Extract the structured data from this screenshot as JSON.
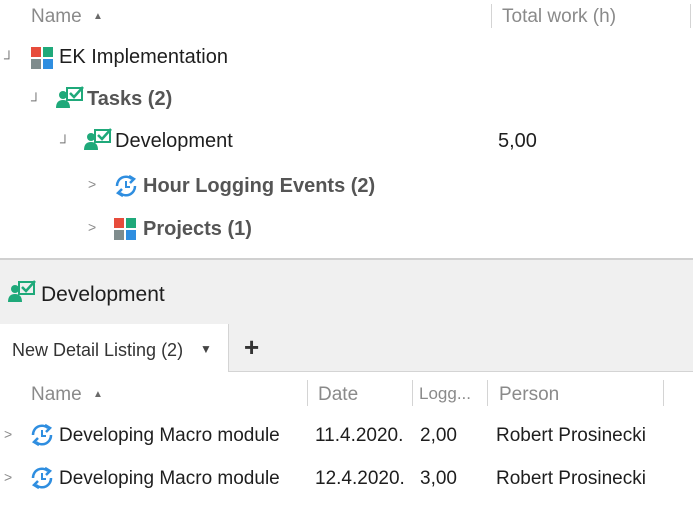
{
  "top_grid": {
    "columns": [
      {
        "label": "Name",
        "sorted": "asc"
      },
      {
        "label": "Total work (h)"
      }
    ],
    "tree": [
      {
        "label": "EK Implementation",
        "icon": "project-icon",
        "value": ""
      },
      {
        "label": "Tasks (2)",
        "icon": "task-icon",
        "value": ""
      },
      {
        "label": "Development",
        "icon": "task-icon",
        "value": "5,00"
      },
      {
        "label": "Hour Logging Events (2)",
        "icon": "hour-logging-icon",
        "value": ""
      },
      {
        "label": "Projects (1)",
        "icon": "project-icon",
        "value": ""
      }
    ]
  },
  "detail": {
    "title": "Development",
    "tab_label": "New Detail Listing (2)",
    "add_tab": "+",
    "columns": [
      "Name",
      "Date",
      "Logg...",
      "Person"
    ],
    "rows": [
      {
        "name": "Developing Macro module",
        "date": "11.4.2020.",
        "logged": "2,00",
        "person": "Robert Prosinecki"
      },
      {
        "name": "Developing Macro module",
        "date": "12.4.2020.",
        "logged": "3,00",
        "person": "Robert Prosinecki"
      }
    ]
  },
  "colors": {
    "header_bg": "#f0f0f0",
    "tab_bar_bg": "#f0f0f0",
    "accent_blue": "#2f8ee0",
    "task_green": "#1fa97a",
    "separator": "#d4d4d4"
  }
}
